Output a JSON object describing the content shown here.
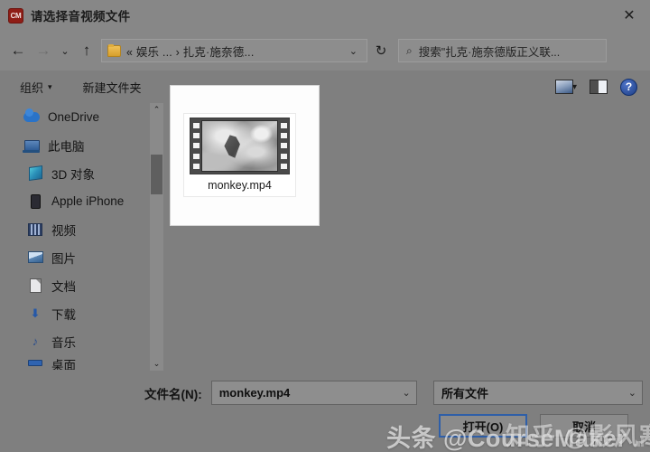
{
  "window": {
    "title": "请选择音视频文件",
    "app_icon_label": "CM",
    "close_label": "✕"
  },
  "nav": {
    "back": "←",
    "forward": "→",
    "history": "⌄",
    "up": "↑",
    "breadcrumb": "« 娱乐 ...  ›  扎克·施奈德...",
    "breadcrumb_chevron": "⌄",
    "refresh": "↻",
    "search_icon": "⌕",
    "search_text": "搜索\"扎克·施奈德版正义联..."
  },
  "toolbar": {
    "organize": "组织",
    "organize_caret": "▾",
    "new_folder": "新建文件夹",
    "view_caret": "▾",
    "help_label": "?"
  },
  "sidebar": {
    "items": [
      {
        "label": "OneDrive",
        "icon": "onedrive-icon"
      },
      {
        "label": "此电脑",
        "icon": "this-pc-icon"
      },
      {
        "label": "3D 对象",
        "icon": "3d-objects-icon"
      },
      {
        "label": "Apple iPhone",
        "icon": "apple-iphone-icon"
      },
      {
        "label": "视频",
        "icon": "videos-icon"
      },
      {
        "label": "图片",
        "icon": "pictures-icon"
      },
      {
        "label": "文档",
        "icon": "documents-icon"
      },
      {
        "label": "下载",
        "icon": "downloads-icon"
      },
      {
        "label": "音乐",
        "icon": "music-icon"
      },
      {
        "label": "桌面",
        "icon": "desktop-icon"
      }
    ],
    "scroll_up": "⌃",
    "scroll_down": "⌄"
  },
  "files": [
    {
      "name": "monkey.mp4",
      "icon": "video-thumbnail"
    }
  ],
  "form": {
    "filename_label": "文件名(N):",
    "filename_value": "monkey.mp4",
    "filetype_value": "所有文件",
    "chevron": "⌄",
    "open_button": "打开(O)",
    "cancel_button": "取消"
  },
  "watermarks": {
    "primary": "头条 @CourseMaker",
    "secondary": "知乎 @影风寒"
  },
  "colors": {
    "accent": "#2f5fa8",
    "app_icon": "#8f1d16",
    "window_chrome": "#7f7f7f"
  }
}
